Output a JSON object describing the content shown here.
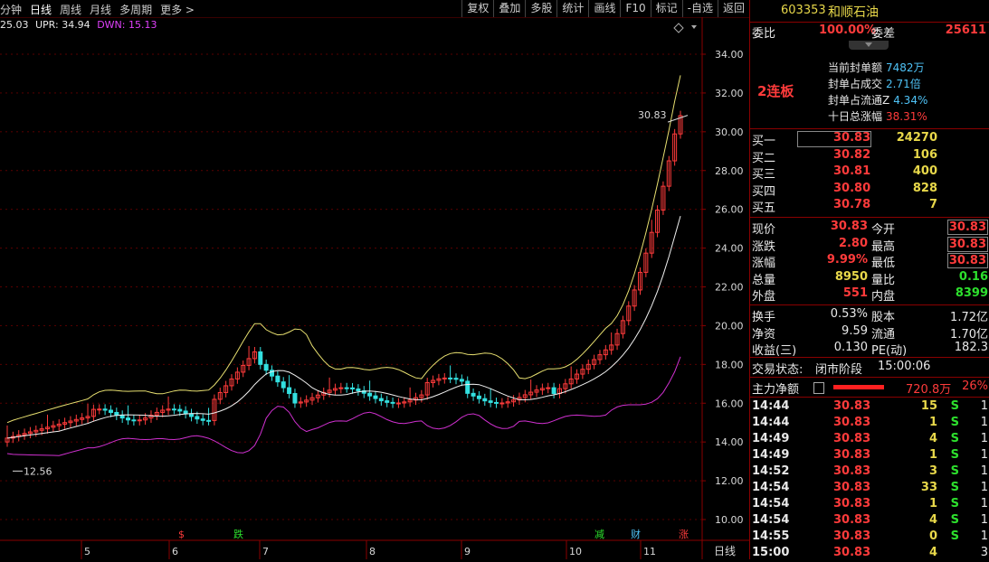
{
  "toolbar": {
    "left": [
      "分钟",
      "日线",
      "周线",
      "月线",
      "多周期",
      "更多 >"
    ],
    "active": "日线",
    "right": [
      "复权",
      "叠加",
      "多股",
      "统计",
      "画线",
      "F10",
      "标记",
      "-自选",
      "返回"
    ]
  },
  "band_info": {
    "prefix": "25.03",
    "upr": "UPR: 34.94",
    "dwn": "DWN: 15.13"
  },
  "chart": {
    "price_labels": [
      "34.00",
      "32.00",
      "30.00",
      "28.00",
      "26.00",
      "24.00",
      "22.00",
      "20.00",
      "18.00",
      "16.00",
      "14.00",
      "12.00",
      "10.00"
    ],
    "dates": [
      "5",
      "6",
      "7",
      "8",
      "9",
      "10",
      "11"
    ],
    "period_label": "日线",
    "annotation_high": "30.83",
    "annotation_low": "12.56",
    "markers": [
      {
        "text": "$",
        "color": "#ff3b3b"
      },
      {
        "text": "跌",
        "color": "#2de02d"
      },
      {
        "text": "减",
        "color": "#2de02d"
      },
      {
        "text": "财",
        "color": "#4fc3f7"
      },
      {
        "text": "涨",
        "color": "#ff3b3b"
      }
    ]
  },
  "stock": {
    "code": "603353",
    "name": "和顺石油"
  },
  "ratio": {
    "weibi_label": "委比",
    "weibi": "100.00%",
    "weicha_label": "委差",
    "weicha": "25611"
  },
  "limit": {
    "badge": "2连板",
    "lines": [
      {
        "label": "当前封单额",
        "value": "7482万"
      },
      {
        "label": "封单占成交",
        "value": "2.71倍"
      },
      {
        "label": "封单占流通Z",
        "value": "4.34%"
      },
      {
        "label": "十日总涨幅",
        "value": "38.31%"
      }
    ]
  },
  "bids": [
    {
      "label": "买一",
      "price": "30.83",
      "vol": "24270"
    },
    {
      "label": "买二",
      "price": "30.82",
      "vol": "106"
    },
    {
      "label": "买三",
      "price": "30.81",
      "vol": "400"
    },
    {
      "label": "买四",
      "price": "30.80",
      "vol": "828"
    },
    {
      "label": "买五",
      "price": "30.78",
      "vol": "7"
    }
  ],
  "quote": [
    {
      "l1": "现价",
      "v1": "30.83",
      "l2": "今开",
      "v2": "30.83"
    },
    {
      "l1": "涨跌",
      "v1": "2.80",
      "l2": "最高",
      "v2": "30.83"
    },
    {
      "l1": "涨幅",
      "v1": "9.99%",
      "l2": "最低",
      "v2": "30.83"
    },
    {
      "l1": "总量",
      "v1": "8950",
      "l2": "量比",
      "v2": "0.16"
    },
    {
      "l1": "外盘",
      "v1": "551",
      "l2": "内盘",
      "v2": "8399"
    }
  ],
  "fund": [
    {
      "l1": "换手",
      "v1": "0.53%",
      "l2": "股本",
      "v2": "1.72亿"
    },
    {
      "l1": "净资",
      "v1": "9.59",
      "l2": "流通",
      "v2": "1.70亿"
    },
    {
      "l1": "收益(三)",
      "v1": "0.130",
      "l2": "PE(动)",
      "v2": "182.3"
    }
  ],
  "status": {
    "label": "交易状态:",
    "value": "闭市阶段",
    "time": "15:00:06"
  },
  "flow": {
    "label": "主力净额",
    "value": "720.8万",
    "pct": "26%"
  },
  "ticks": [
    {
      "t": "14:44",
      "p": "30.83",
      "v": "15",
      "s": "S",
      "n": "1"
    },
    {
      "t": "14:44",
      "p": "30.83",
      "v": "1",
      "s": "S",
      "n": "1"
    },
    {
      "t": "14:49",
      "p": "30.83",
      "v": "4",
      "s": "S",
      "n": "1"
    },
    {
      "t": "14:49",
      "p": "30.83",
      "v": "1",
      "s": "S",
      "n": "1"
    },
    {
      "t": "14:52",
      "p": "30.83",
      "v": "3",
      "s": "S",
      "n": "1"
    },
    {
      "t": "14:54",
      "p": "30.83",
      "v": "33",
      "s": "S",
      "n": "1"
    },
    {
      "t": "14:54",
      "p": "30.83",
      "v": "1",
      "s": "S",
      "n": "1"
    },
    {
      "t": "14:54",
      "p": "30.83",
      "v": "4",
      "s": "S",
      "n": "1"
    },
    {
      "t": "14:55",
      "p": "30.83",
      "v": "0",
      "s": "S",
      "n": "1"
    },
    {
      "t": "15:00",
      "p": "30.83",
      "v": "4",
      "s": "",
      "n": "3"
    }
  ]
}
